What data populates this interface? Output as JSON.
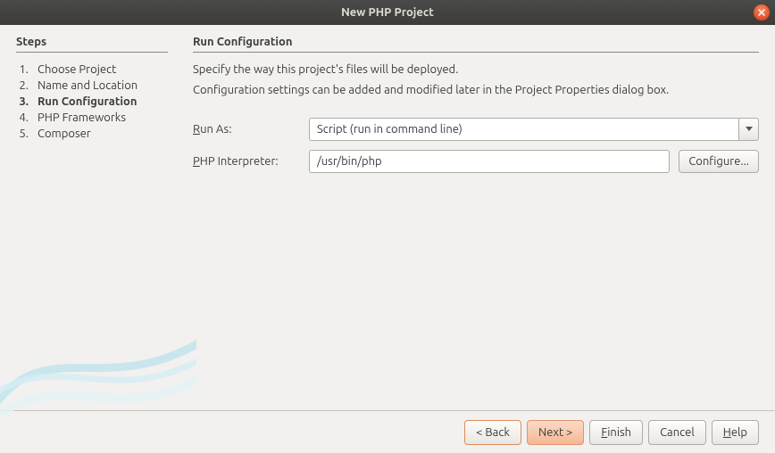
{
  "window": {
    "title": "New PHP Project"
  },
  "sidebar": {
    "heading": "Steps",
    "steps": [
      {
        "num": "1.",
        "label": "Choose Project"
      },
      {
        "num": "2.",
        "label": "Name and Location"
      },
      {
        "num": "3.",
        "label": "Run Configuration"
      },
      {
        "num": "4.",
        "label": "PHP Frameworks"
      },
      {
        "num": "5.",
        "label": "Composer"
      }
    ],
    "active_index": 2
  },
  "main": {
    "heading": "Run Configuration",
    "desc1": "Specify the way this project's files will be deployed.",
    "desc2": "Configuration settings can be added and modified later in the Project Properties dialog box.",
    "run_as_label_pre": "R",
    "run_as_label_post": "un As:",
    "run_as_value": "Script (run in command line)",
    "php_label_pre": "P",
    "php_label_post": "HP Interpreter:",
    "php_value": "/usr/bin/php",
    "configure_label": "Configure..."
  },
  "footer": {
    "back": "< Back",
    "next": "Next >",
    "finish_pre": "F",
    "finish_post": "inish",
    "cancel": "Cancel",
    "help_pre": "H",
    "help_post": "elp"
  }
}
